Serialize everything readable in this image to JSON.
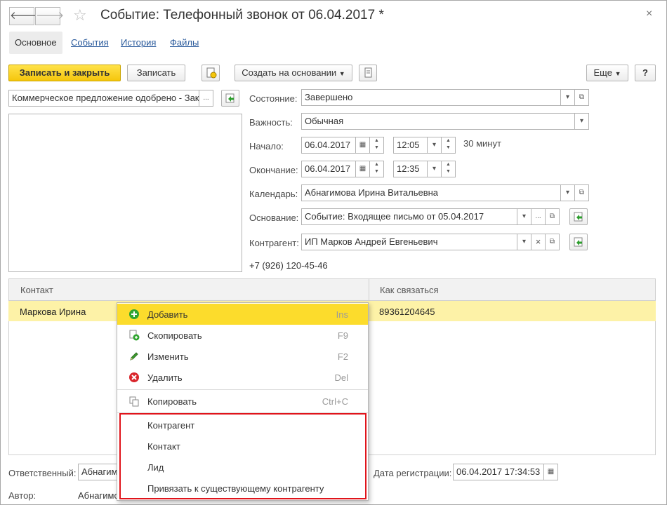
{
  "window": {
    "title": "Событие: Телефонный звонок от 06.04.2017 *",
    "back_glyph": "🡐",
    "forward_glyph": "🡒",
    "star_glyph": "☆",
    "close_glyph": "×"
  },
  "tabs": [
    {
      "label": "Основное",
      "active": true
    },
    {
      "label": "События"
    },
    {
      "label": "История"
    },
    {
      "label": "Файлы"
    }
  ],
  "toolbar": {
    "save_close": "Записать и закрыть",
    "save": "Записать",
    "create_based": "Создать на основании",
    "more": "Еще",
    "help": "?"
  },
  "subject": {
    "value": "Коммерческое предложение одобрено - Зак",
    "btn": "..."
  },
  "form": {
    "state": {
      "label": "Состояние:",
      "value": "Завершено"
    },
    "importance": {
      "label": "Важность:",
      "value": "Обычная"
    },
    "start": {
      "label": "Начало:",
      "date": "06.04.2017",
      "time": "12:05",
      "duration": "30 минут"
    },
    "end": {
      "label": "Окончание:",
      "date": "06.04.2017",
      "time": "12:35"
    },
    "calendar": {
      "label": "Календарь:",
      "value": "Абнагимова Ирина Витальевна"
    },
    "basis": {
      "label": "Основание:",
      "value": "Событие: Входящее письмо от 05.04.2017",
      "btn": "..."
    },
    "counterparty": {
      "label": "Контрагент:",
      "value": "ИП Марков Андрей Евгеньевич",
      "clear": "×"
    },
    "phone": "+7 (926) 120-45-46"
  },
  "grid": {
    "columns": [
      "Контакт",
      "Как связаться"
    ],
    "rows": [
      {
        "contact": "Маркова Ирина",
        "how": "89361204645"
      }
    ]
  },
  "context_menu": {
    "items": [
      {
        "label": "Добавить",
        "key": "Ins",
        "icon": "add-icon"
      },
      {
        "label": "Скопировать",
        "key": "F9",
        "icon": "copy-icon"
      },
      {
        "label": "Изменить",
        "key": "F2",
        "icon": "edit-icon"
      },
      {
        "label": "Удалить",
        "key": "Del",
        "icon": "delete-icon"
      },
      {
        "label": "Копировать",
        "key": "Ctrl+C",
        "icon": "clipboard-icon"
      },
      {
        "label": "Контрагент"
      },
      {
        "label": "Контакт"
      },
      {
        "label": "Лид"
      },
      {
        "label": "Привязать к существующему контрагенту"
      }
    ]
  },
  "footer": {
    "responsible_label": "Ответственный:",
    "responsible_value": "Абнагим",
    "author_label": "Автор:",
    "author_value": "Абнагимо",
    "reg_label": "Дата регистрации:",
    "reg_value": "06.04.2017 17:34:53"
  },
  "colors": {
    "accent": "#f5c60c",
    "highlight": "#fcdc2c",
    "row": "#fdf2a7",
    "link": "#2a5a9c",
    "red_frame": "#e0141b"
  }
}
